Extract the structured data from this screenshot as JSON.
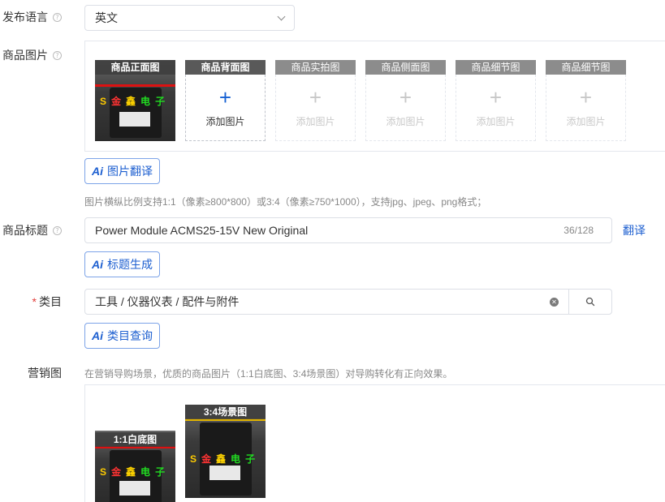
{
  "language": {
    "label": "发布语言",
    "value": "英文"
  },
  "images": {
    "label": "商品图片",
    "slots": [
      {
        "caption": "商品正面图"
      },
      {
        "caption": "商品背面图",
        "add_text": "添加图片"
      },
      {
        "caption": "商品实拍图",
        "add_text": "添加图片"
      },
      {
        "caption": "商品侧面图",
        "add_text": "添加图片"
      },
      {
        "caption": "商品细节图",
        "add_text": "添加图片"
      },
      {
        "caption": "商品细节图",
        "add_text": "添加图片"
      }
    ],
    "ai_button": "图片翻译",
    "hint": "图片横纵比例支持1:1（像素≥800*800）或3:4（像素≥750*1000），支持jpg、jpeg、png格式；"
  },
  "title": {
    "label": "商品标题",
    "value": "Power Module ACMS25-15V New Original",
    "counter": "36/128",
    "translate_link": "翻译",
    "ai_button": "标题生成"
  },
  "category": {
    "label": "类目",
    "value": "工具 / 仪器仪表 / 配件与附件",
    "ai_button": "类目查询"
  },
  "marketing": {
    "label": "营销图",
    "hint": "在营销导购场景，优质的商品图片（1:1白底图、3:4场景图）对导购转化有正向效果。",
    "images": [
      {
        "caption": "1:1白底图"
      },
      {
        "caption": "3:4场景图"
      }
    ]
  },
  "watermark": "S金鑫电子",
  "colors": {
    "accent": "#1d5fd0",
    "required": "#e23c39",
    "border": "#dcdfe6"
  }
}
